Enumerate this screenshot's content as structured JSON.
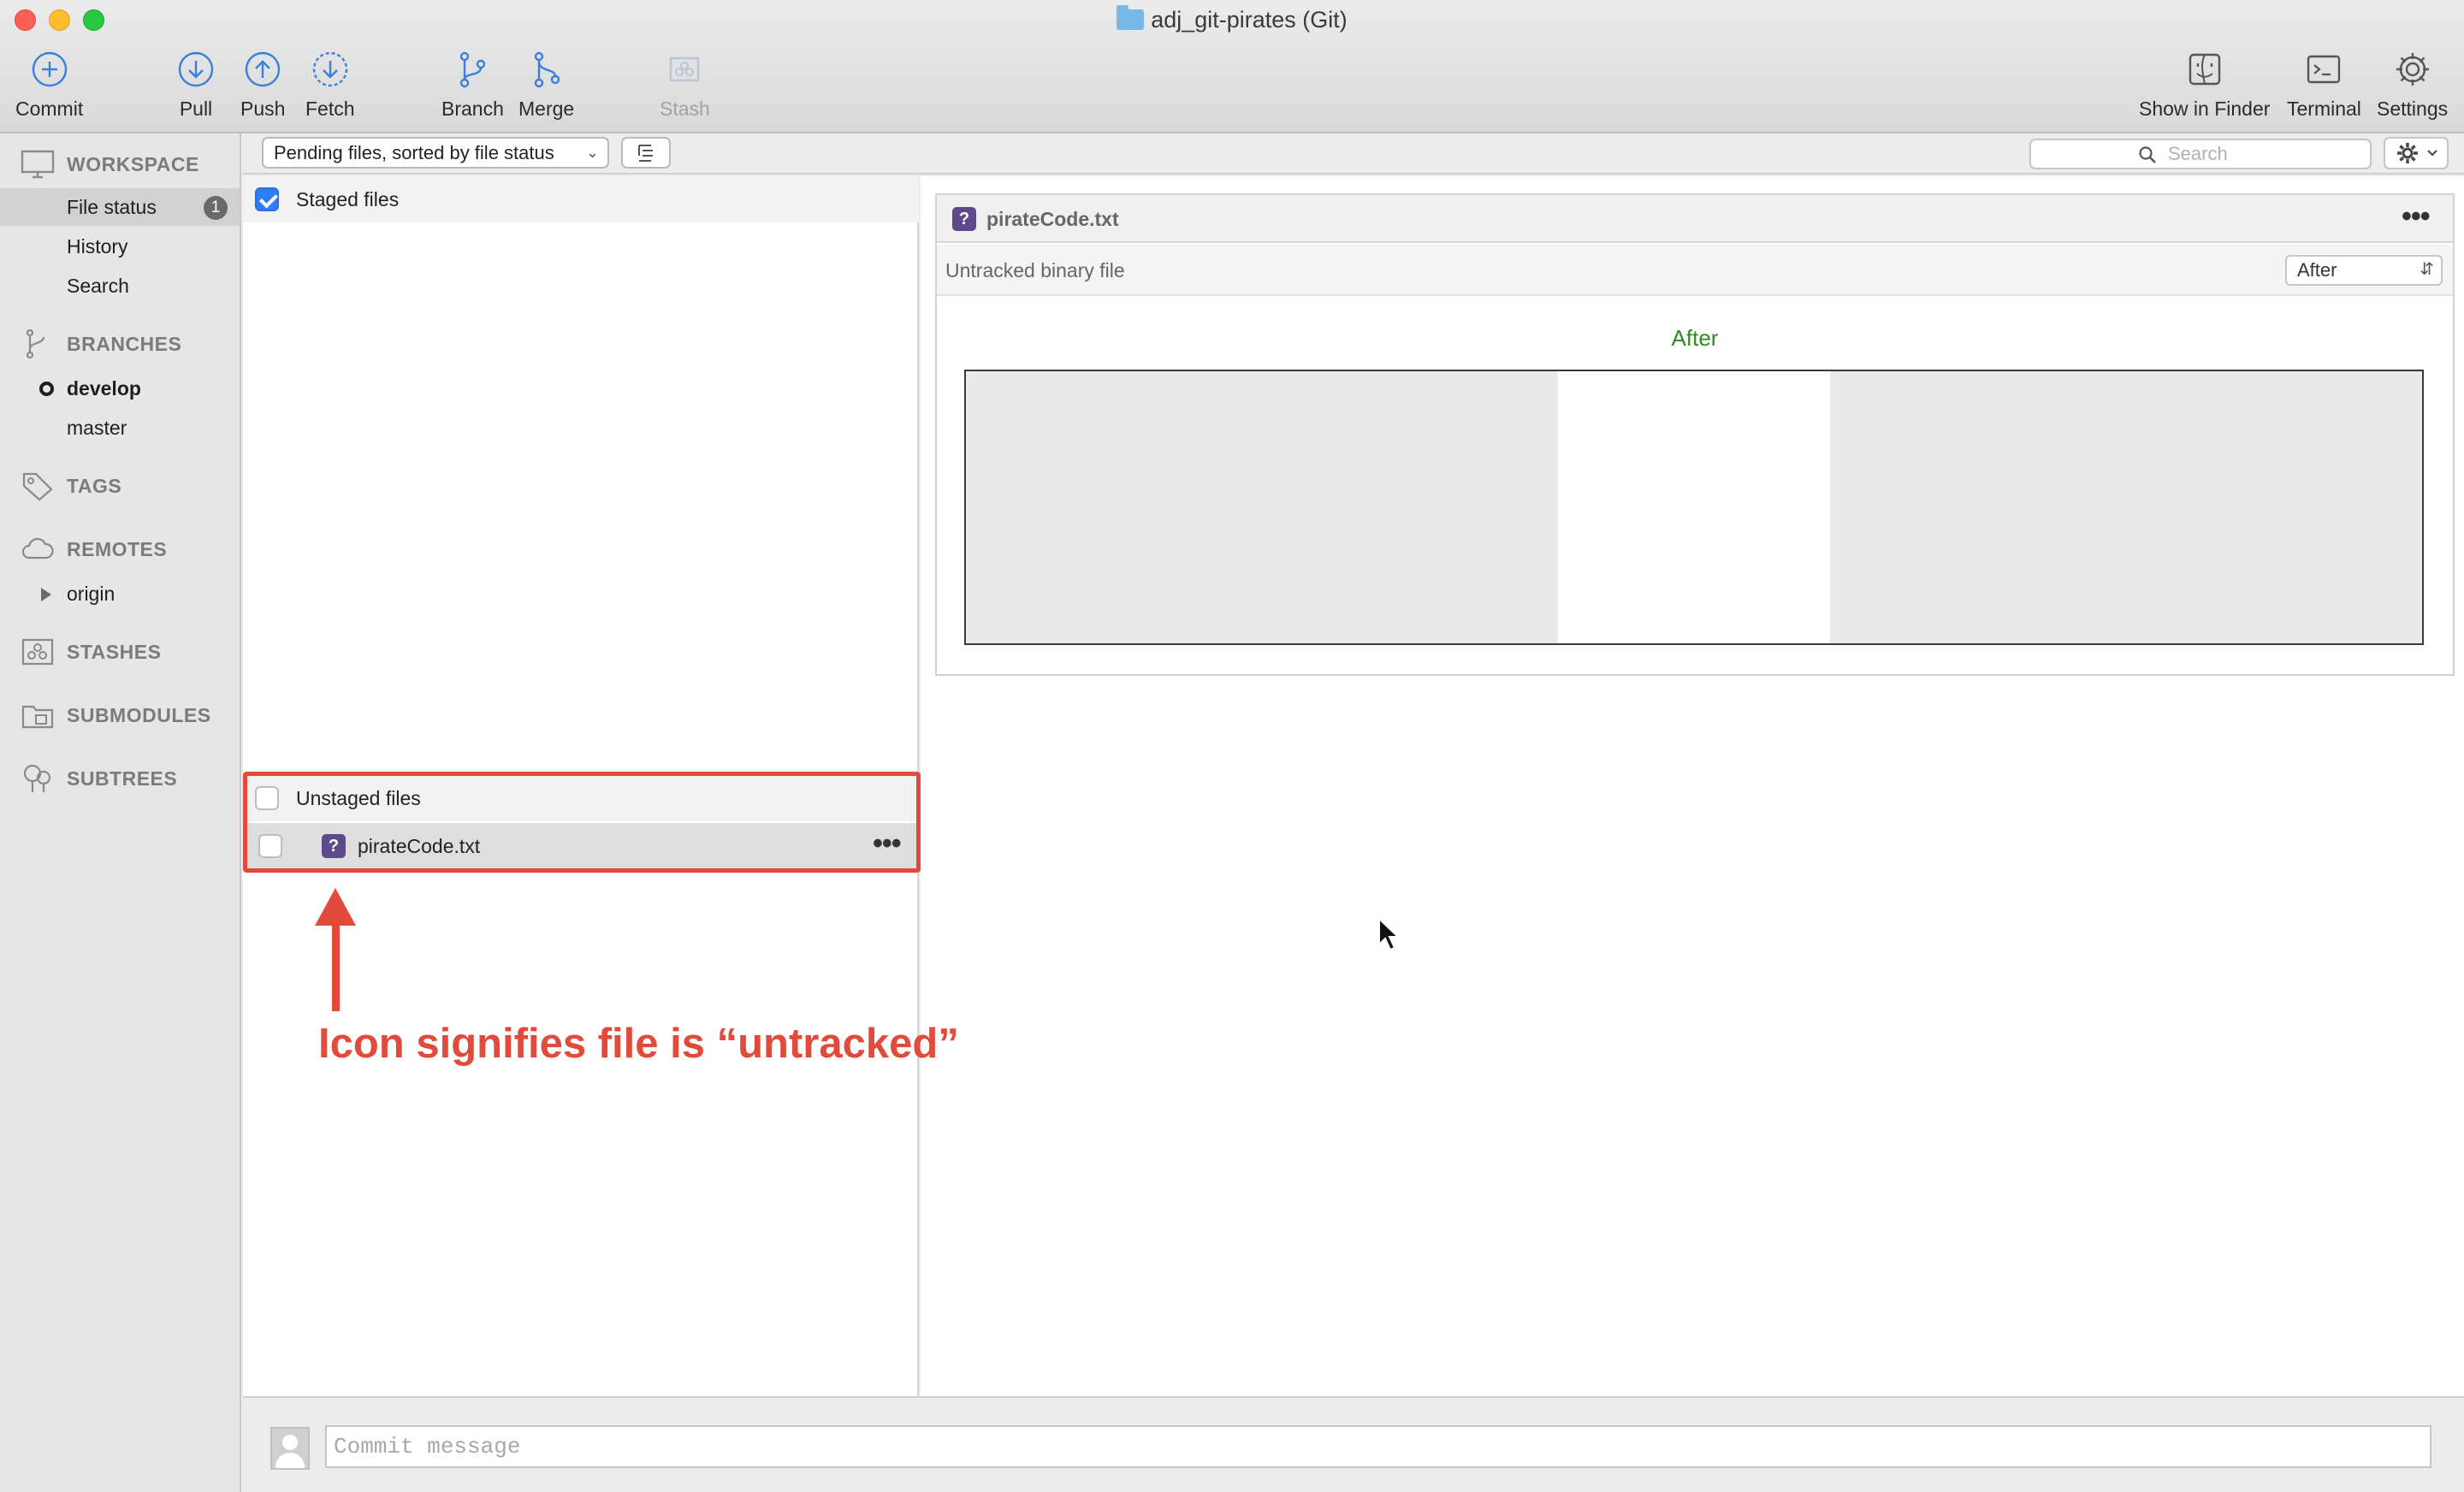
{
  "window": {
    "title": "adj_git-pirates (Git)"
  },
  "toolbar": {
    "commit": "Commit",
    "pull": "Pull",
    "push": "Push",
    "fetch": "Fetch",
    "branch": "Branch",
    "merge": "Merge",
    "stash": "Stash",
    "show_in_finder": "Show in Finder",
    "terminal": "Terminal",
    "settings": "Settings"
  },
  "sidebar": {
    "workspace": {
      "header": "WORKSPACE",
      "items": [
        {
          "label": "File status",
          "badge": "1",
          "selected": true
        },
        {
          "label": "History"
        },
        {
          "label": "Search"
        }
      ]
    },
    "branches": {
      "header": "BRANCHES",
      "items": [
        {
          "label": "develop",
          "current": true
        },
        {
          "label": "master"
        }
      ]
    },
    "tags": {
      "header": "TAGS"
    },
    "remotes": {
      "header": "REMOTES",
      "items": [
        {
          "label": "origin"
        }
      ]
    },
    "stashes": {
      "header": "STASHES"
    },
    "submodules": {
      "header": "SUBMODULES"
    },
    "subtrees": {
      "header": "SUBTREES"
    }
  },
  "filterbar": {
    "sort_label": "Pending files, sorted by file status",
    "search_placeholder": "Search"
  },
  "filelist": {
    "staged": {
      "label": "Staged files",
      "checked": true
    },
    "unstaged": {
      "label": "Unstaged files",
      "checked": false,
      "files": [
        {
          "name": "pirateCode.txt",
          "status_icon": "untracked-question-icon",
          "status_glyph": "?"
        }
      ]
    }
  },
  "diff": {
    "filename": "pirateCode.txt",
    "status_glyph": "?",
    "description": "Untracked binary file",
    "version_select": "After",
    "preview_label": "After"
  },
  "commit": {
    "placeholder": "Commit message"
  },
  "annotation": {
    "text": "Icon signifies file is “untracked”",
    "color": "#e24b3b"
  },
  "colors": {
    "accent": "#2f7df6",
    "untracked_icon": "#5d4a8a",
    "after_label": "#2c8a1e",
    "annotation": "#e24b3b"
  }
}
